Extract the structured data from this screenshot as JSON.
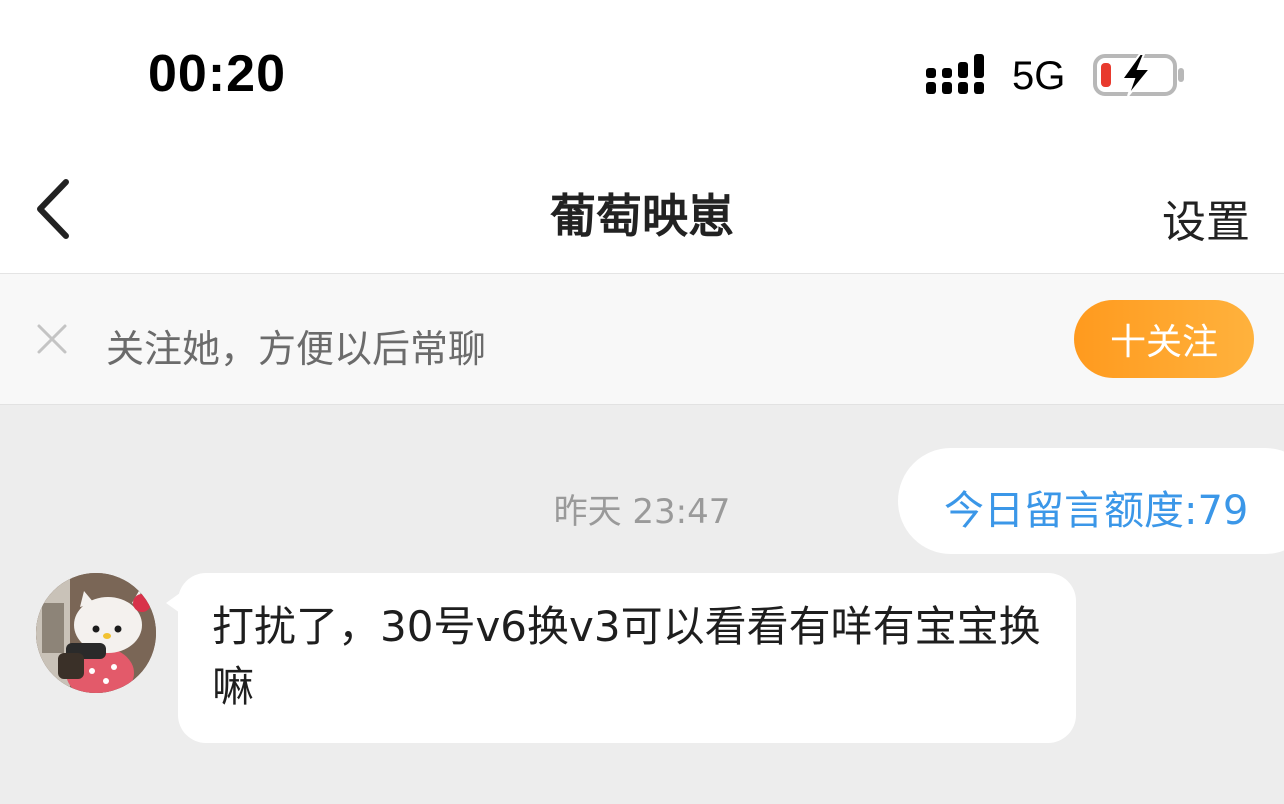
{
  "status_bar": {
    "time": "00:20",
    "network": "5G",
    "icons": [
      "signal-icon",
      "battery-charging-icon"
    ],
    "battery_color": "#e83a2e"
  },
  "nav": {
    "title": "葡萄映崽",
    "settings_label": "设置",
    "back_icon": "chevron-left-icon"
  },
  "follow_banner": {
    "text": "关注她，方便以后常聊",
    "button_label": "十关注",
    "button_color": "#ff9f24",
    "close_icon": "close-icon"
  },
  "chat": {
    "quota_text": "今日留言额度:79",
    "timestamp": "昨天 23:47",
    "messages": [
      {
        "sender": "other",
        "avatar_icon": "hello-kitty-avatar",
        "text": "打扰了，30号v6换v3可以看看有咩有宝宝换嘛"
      }
    ],
    "link_color": "#3b97e8"
  }
}
